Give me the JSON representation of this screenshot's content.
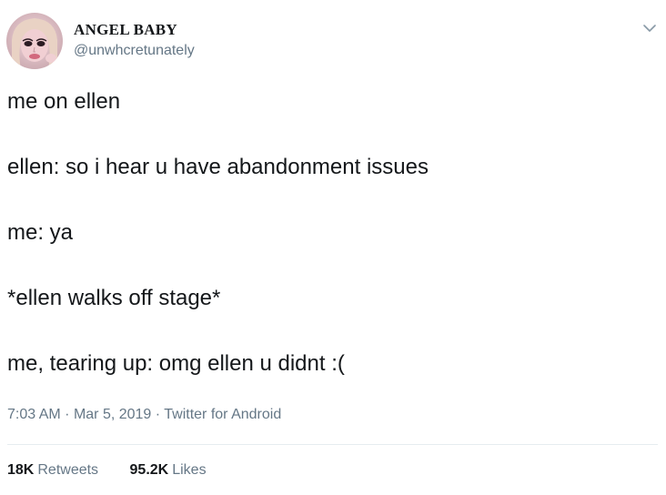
{
  "author": {
    "display_name": "ANGEL BABY",
    "handle": "@unwhcretunately",
    "avatar_icon": "doll-face-avatar"
  },
  "menu_icon": "chevron-down-icon",
  "tweet": {
    "lines": [
      "me on ellen",
      "ellen: so i hear u have abandonment issues",
      "me: ya",
      "*ellen walks off stage*",
      "me, tearing up: omg ellen u didnt :("
    ]
  },
  "meta": {
    "time": "7:03 AM",
    "separator": "·",
    "date": "Mar 5, 2019",
    "source": "Twitter for Android"
  },
  "stats": {
    "retweets_count": "18K",
    "retweets_label": "Retweets",
    "likes_count": "95.2K",
    "likes_label": "Likes"
  },
  "colors": {
    "text": "#14171a",
    "secondary": "#657786",
    "divider": "#e6ecf0"
  }
}
